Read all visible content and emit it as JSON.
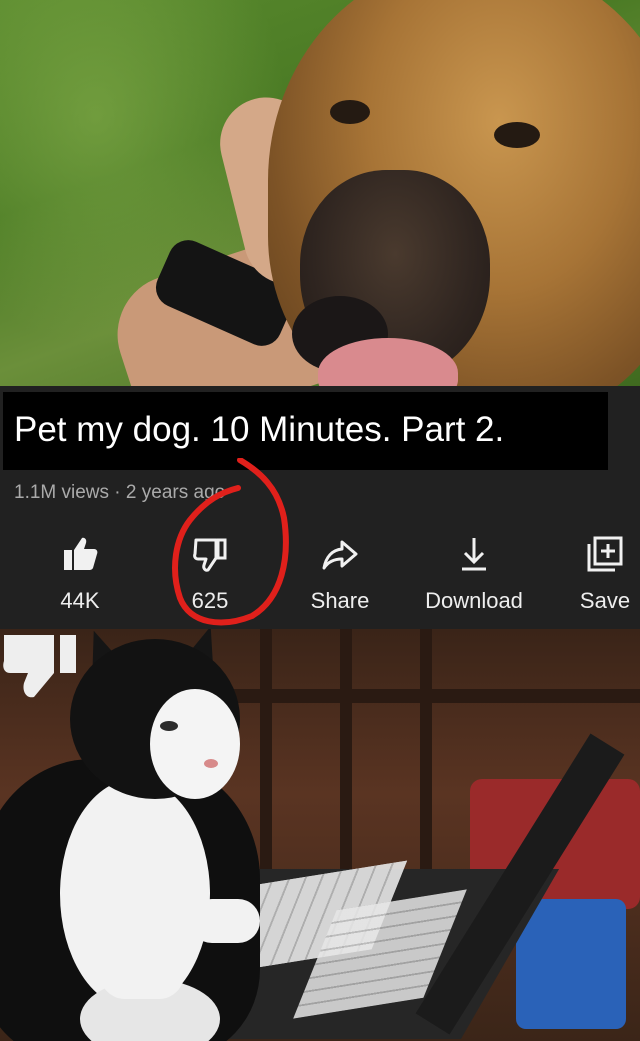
{
  "video": {
    "title": "Pet my dog. 10 Minutes. Part 2.",
    "meta": "1.1M views · 2 years ago"
  },
  "actions": {
    "like": {
      "label": "44K",
      "icon": "thumbs-up-icon"
    },
    "dislike": {
      "label": "625",
      "icon": "thumbs-down-icon"
    },
    "share": {
      "label": "Share",
      "icon": "share-arrow-icon"
    },
    "download": {
      "label": "Download",
      "icon": "download-icon"
    },
    "save": {
      "label": "Save",
      "icon": "add-to-playlist-icon"
    }
  },
  "colors": {
    "panel_background": "#212121",
    "title_background": "#000000",
    "annotation_circle": "#e0201b"
  }
}
